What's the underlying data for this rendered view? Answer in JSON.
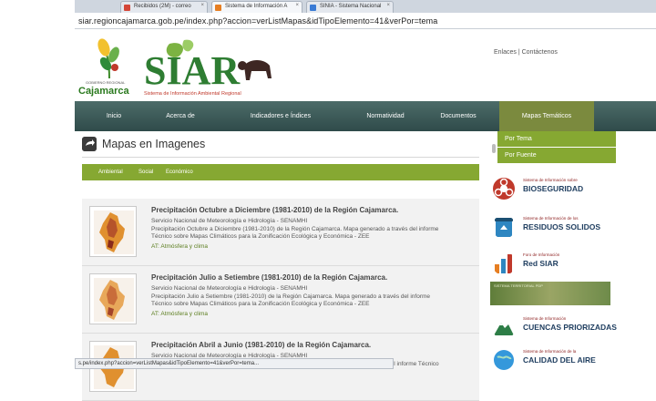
{
  "browser": {
    "tabs": [
      {
        "label": "Recibidos (2M) - correo",
        "color": "#d44638"
      },
      {
        "label": "Sistema de Información A",
        "color": "#e67e22"
      },
      {
        "label": "SINIA - Sistema Nacional",
        "color": "#3a7bd5"
      }
    ],
    "close_glyph": "×",
    "url": "siar.regioncajamarca.gob.pe/index.php?accion=verListMapas&idTipoElemento=41&verPor=tema",
    "status_url": "s.pe/index.php?accion=verListMapas&idTipoElemento=41&verPor=tema..."
  },
  "header": {
    "gr_small": "GOBIERNO REGIONAL",
    "gr_big": "Cajamarca",
    "siar_logo": "SIAR",
    "siar_subtitle": "Sistema de Información Ambiental Regional",
    "top_links": "Enlaces | Contáctenos"
  },
  "nav": {
    "items": [
      "Inicio",
      "Acerca de",
      "Indicadores e Índices",
      "Normatividad",
      "Documentos",
      "Mapas Temáticos"
    ],
    "dropdown": [
      "Por Tema",
      "Por Fuente"
    ]
  },
  "page": {
    "heading": "Mapas en Imagenes",
    "subtabs": [
      "Ambiental",
      "Social",
      "Económico"
    ]
  },
  "items": [
    {
      "title": "Precipitación Octubre a Diciembre (1981-2010) de la Región Cajamarca.",
      "source": "Servicio Nacional de Meteorología e Hidrología - SENAMHI",
      "desc1": "Precipitación Octubre a Diciembre (1981-2010) de la Región Cajamarca. Mapa generado a través del informe",
      "desc2": "Técnico sobre Mapas Climáticos para la Zonificación Ecológica y Económica - ZEE",
      "link": "AT: Atmósfera y clima"
    },
    {
      "title": "Precipitación Julio a Setiembre (1981-2010) de la Región Cajamarca.",
      "source": "Servicio Nacional de Meteorología e Hidrología - SENAMHI",
      "desc1": "Precipitación Julio a Setiembre (1981-2010) de la Región Cajamarca. Mapa generado a través del informe",
      "desc2": "Técnico sobre Mapas Climáticos para la Zonificación Ecológica y Económica - ZEE",
      "link": "AT: Atmósfera y clima"
    },
    {
      "title": "Precipitación Abril a Junio (1981-2010) de la Región Cajamarca.",
      "source": "Servicio Nacional de Meteorología e Hidrología - SENAMHI",
      "desc1": "Precipitación Abril a Junio (1981-2010) de la Región Cajamarca. Mapa generado a través del informe Técnico",
      "desc2": "",
      "link": ""
    }
  ],
  "sidebar": [
    {
      "small": "Sistema de Información sobre",
      "big": "BIOSEGURIDAD",
      "icon": "biohazard-icon",
      "color": "#c0392b"
    },
    {
      "small": "Sistema de Información de los",
      "big": "RESIDUOS SOLIDOS",
      "icon": "recycle-icon",
      "color": "#2e86c1"
    },
    {
      "small": "Foro de Información",
      "big": "Red SIAR",
      "icon": "bar-chart-icon",
      "color": "#e67e22"
    },
    {
      "small": "Sistema de Información",
      "big": "CUENCAS PRIORIZADAS",
      "icon": "mountain-icon",
      "color": "#2d7d46"
    },
    {
      "small": "Sistema de Información de la",
      "big": "CALIDAD DEL AIRE",
      "icon": "globe-icon",
      "color": "#3498db"
    }
  ],
  "banner_text": "SISTEMA TERRITORIAL PDP"
}
